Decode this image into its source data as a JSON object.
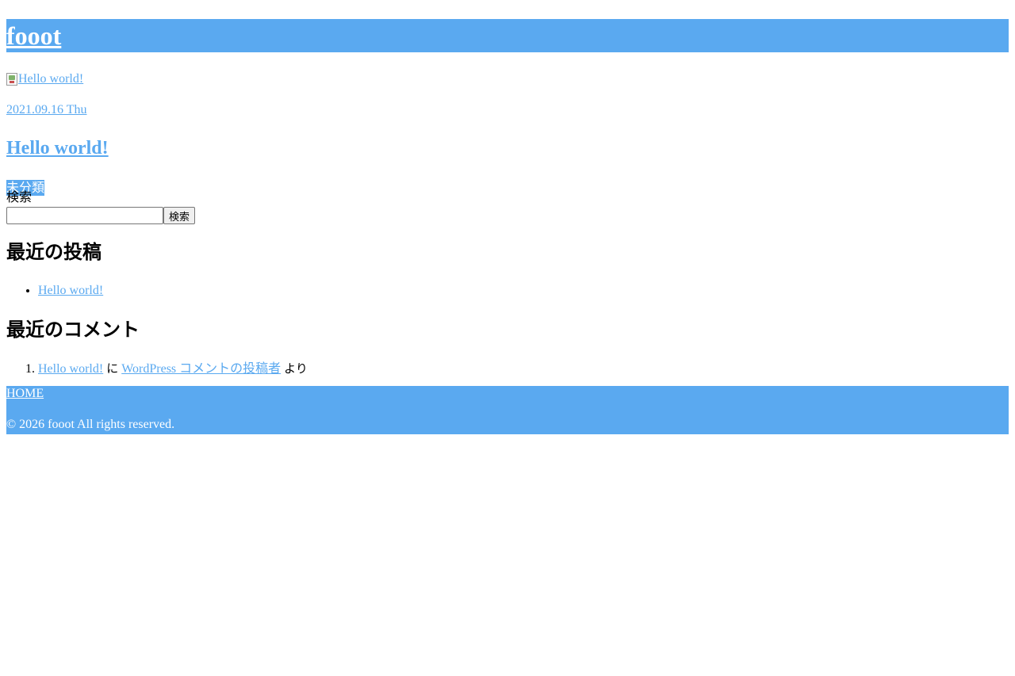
{
  "header": {
    "site_title": "fooot"
  },
  "post": {
    "thumbnail_alt": "Hello world!",
    "date": "2021.09.16 Thu",
    "title": "Hello world!",
    "category": "未分類"
  },
  "search": {
    "label": "検索",
    "value": "",
    "placeholder": "",
    "button_label": "検索"
  },
  "recent_posts": {
    "title": "最近の投稿",
    "items": [
      {
        "label": "Hello world!"
      }
    ]
  },
  "recent_comments": {
    "title": "最近のコメント",
    "items": [
      {
        "number": "1.",
        "post_link": "Hello world!",
        "connector": "に",
        "author_link": "WordPress コメントの投稿者",
        "suffix": "より"
      }
    ]
  },
  "footer": {
    "home_link": "HOME",
    "copyright": "© 2026 fooot All rights reserved."
  },
  "colors": {
    "accent": "#5aa9f0",
    "text_on_accent": "#ffffff"
  },
  "icons": {
    "broken_image": "broken-image-icon"
  }
}
